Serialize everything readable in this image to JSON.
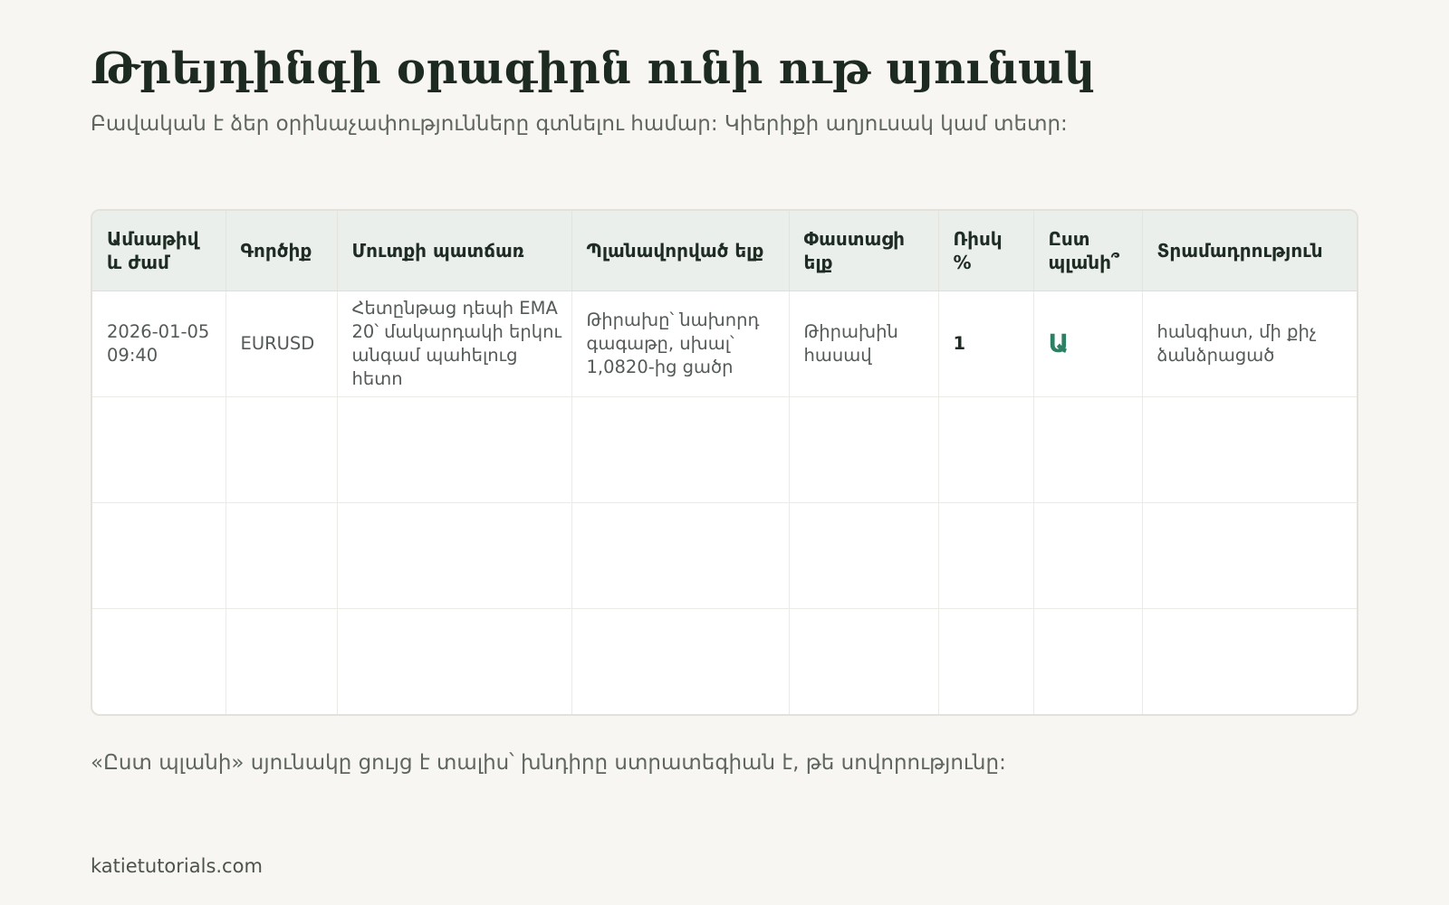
{
  "page": {
    "title": "Թրեյդինգի օրագիրն ունի ութ սյունակ",
    "subtitle": "Բավական է ձեր օրինաչափությունները գտնելու համար: Կիերիքի աղյուսակ կամ տետր:",
    "note": "«Ըստ պլանի» սյունակը ցույց է տալիս՝ խնդիրը ստրատեգիան է, թե սովորությունը:",
    "footer": "katietutorials.com"
  },
  "table": {
    "headers": [
      "Ամսաթիվ և ժամ",
      "Գործիք",
      "Մուտքի պատճառ",
      "Պլանավորված ելք",
      "Փաստացի ելք",
      "Ռիսկ %",
      "Ըստ պլանի՞",
      "Տրամադրություն"
    ],
    "rows": [
      [
        "2026-01-05 09:40",
        "EURUSD",
        "Հետընթաց դեպի EMA 20՝ մակարդակի երկու անգամ պահելուց հետո",
        "Թիրախը՝ նախորդ գագաթը, սխալ՝ 1,0820-ից ցածր",
        "Թիրախին հասավ",
        "1",
        "Ա",
        "հանգիստ, մի քիչ ձանձրացած"
      ],
      [
        "",
        "",
        "",
        "",
        "",
        "",
        "",
        ""
      ],
      [
        "",
        "",
        "",
        "",
        "",
        "",
        "",
        ""
      ],
      [
        "",
        "",
        "",
        "",
        "",
        "",
        "",
        ""
      ]
    ]
  },
  "colors": {
    "background": "#f7f6f2",
    "header_bg": "#ebefeb",
    "accent_green": "#2e8064",
    "title": "#1c2a22"
  }
}
